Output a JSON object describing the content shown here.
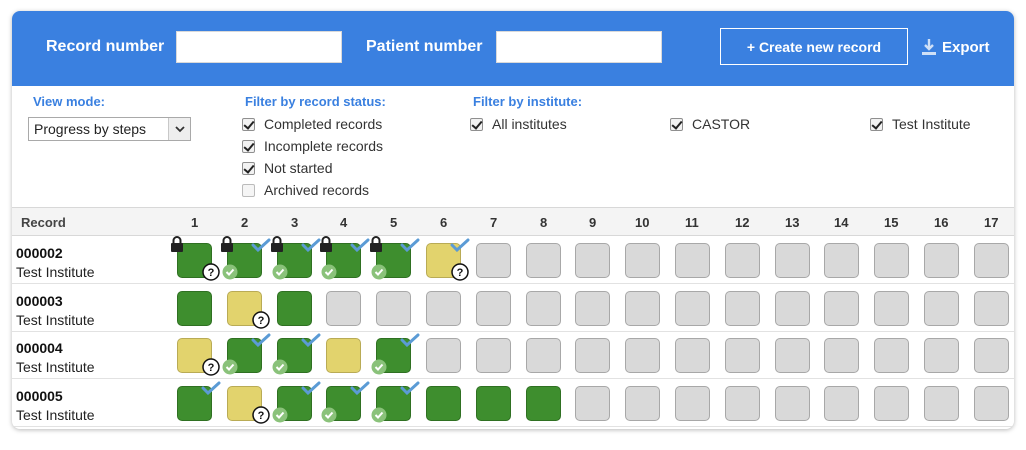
{
  "header": {
    "record_number_label": "Record number",
    "record_number_value": "",
    "patient_number_label": "Patient number",
    "patient_number_value": "",
    "create_button": "+ Create new record",
    "export_button": "Export",
    "accent_color": "#3a80e0"
  },
  "view_mode": {
    "label": "View mode:",
    "selected": "Progress by steps"
  },
  "status_filter": {
    "label": "Filter by record status:",
    "options": [
      {
        "label": "Completed records",
        "checked": true
      },
      {
        "label": "Incomplete records",
        "checked": true
      },
      {
        "label": "Not started",
        "checked": true
      },
      {
        "label": "Archived records",
        "checked": false
      }
    ]
  },
  "institute_filter": {
    "label": "Filter by institute:",
    "options": [
      {
        "label": "All institutes",
        "checked": true
      },
      {
        "label": "CASTOR",
        "checked": true
      },
      {
        "label": "Test Institute",
        "checked": true
      }
    ]
  },
  "grid": {
    "record_header": "Record",
    "steps": [
      "1",
      "2",
      "3",
      "4",
      "5",
      "6",
      "7",
      "8",
      "9",
      "10",
      "11",
      "12",
      "13",
      "14",
      "15",
      "16",
      "17"
    ],
    "status_colors": {
      "green": "#3e8e2e",
      "yellow": "#e2d36d",
      "empty": "#d9d9d9"
    },
    "rows": [
      {
        "id": "000002",
        "institute": "Test Institute",
        "steps": [
          {
            "status": "green",
            "locked": true,
            "verified": false,
            "query": true,
            "signed": false
          },
          {
            "status": "green",
            "locked": true,
            "verified": true,
            "query": false,
            "signed": true
          },
          {
            "status": "green",
            "locked": true,
            "verified": true,
            "query": false,
            "signed": true
          },
          {
            "status": "green",
            "locked": true,
            "verified": true,
            "query": false,
            "signed": true
          },
          {
            "status": "green",
            "locked": true,
            "verified": true,
            "query": false,
            "signed": true
          },
          {
            "status": "yellow",
            "locked": false,
            "verified": true,
            "query": true,
            "signed": false
          },
          {
            "status": "empty"
          },
          {
            "status": "empty"
          },
          {
            "status": "empty"
          },
          {
            "status": "empty"
          },
          {
            "status": "empty"
          },
          {
            "status": "empty"
          },
          {
            "status": "empty"
          },
          {
            "status": "empty"
          },
          {
            "status": "empty"
          },
          {
            "status": "empty"
          },
          {
            "status": "empty"
          }
        ]
      },
      {
        "id": "000003",
        "institute": "Test Institute",
        "steps": [
          {
            "status": "green"
          },
          {
            "status": "yellow",
            "query": true
          },
          {
            "status": "green"
          },
          {
            "status": "empty"
          },
          {
            "status": "empty"
          },
          {
            "status": "empty"
          },
          {
            "status": "empty"
          },
          {
            "status": "empty"
          },
          {
            "status": "empty"
          },
          {
            "status": "empty"
          },
          {
            "status": "empty"
          },
          {
            "status": "empty"
          },
          {
            "status": "empty"
          },
          {
            "status": "empty"
          },
          {
            "status": "empty"
          },
          {
            "status": "empty"
          },
          {
            "status": "empty"
          }
        ]
      },
      {
        "id": "000004",
        "institute": "Test Institute",
        "steps": [
          {
            "status": "yellow",
            "query": true
          },
          {
            "status": "green",
            "verified": true,
            "signed": true
          },
          {
            "status": "green",
            "verified": true,
            "signed": true
          },
          {
            "status": "yellow"
          },
          {
            "status": "green",
            "verified": true,
            "signed": true
          },
          {
            "status": "empty"
          },
          {
            "status": "empty"
          },
          {
            "status": "empty"
          },
          {
            "status": "empty"
          },
          {
            "status": "empty"
          },
          {
            "status": "empty"
          },
          {
            "status": "empty"
          },
          {
            "status": "empty"
          },
          {
            "status": "empty"
          },
          {
            "status": "empty"
          },
          {
            "status": "empty"
          },
          {
            "status": "empty"
          }
        ]
      },
      {
        "id": "000005",
        "institute": "Test Institute",
        "steps": [
          {
            "status": "green",
            "verified": true
          },
          {
            "status": "yellow",
            "query": true
          },
          {
            "status": "green",
            "verified": true,
            "signed": true
          },
          {
            "status": "green",
            "verified": true,
            "signed": true
          },
          {
            "status": "green",
            "verified": true,
            "signed": true
          },
          {
            "status": "green"
          },
          {
            "status": "green"
          },
          {
            "status": "green"
          },
          {
            "status": "empty"
          },
          {
            "status": "empty"
          },
          {
            "status": "empty"
          },
          {
            "status": "empty"
          },
          {
            "status": "empty"
          },
          {
            "status": "empty"
          },
          {
            "status": "empty"
          },
          {
            "status": "empty"
          },
          {
            "status": "empty"
          }
        ]
      }
    ],
    "icons": {
      "lock": "lock-icon",
      "verified": "checkmark-icon",
      "query": "question-icon",
      "signed": "green-check-circle-icon"
    }
  }
}
